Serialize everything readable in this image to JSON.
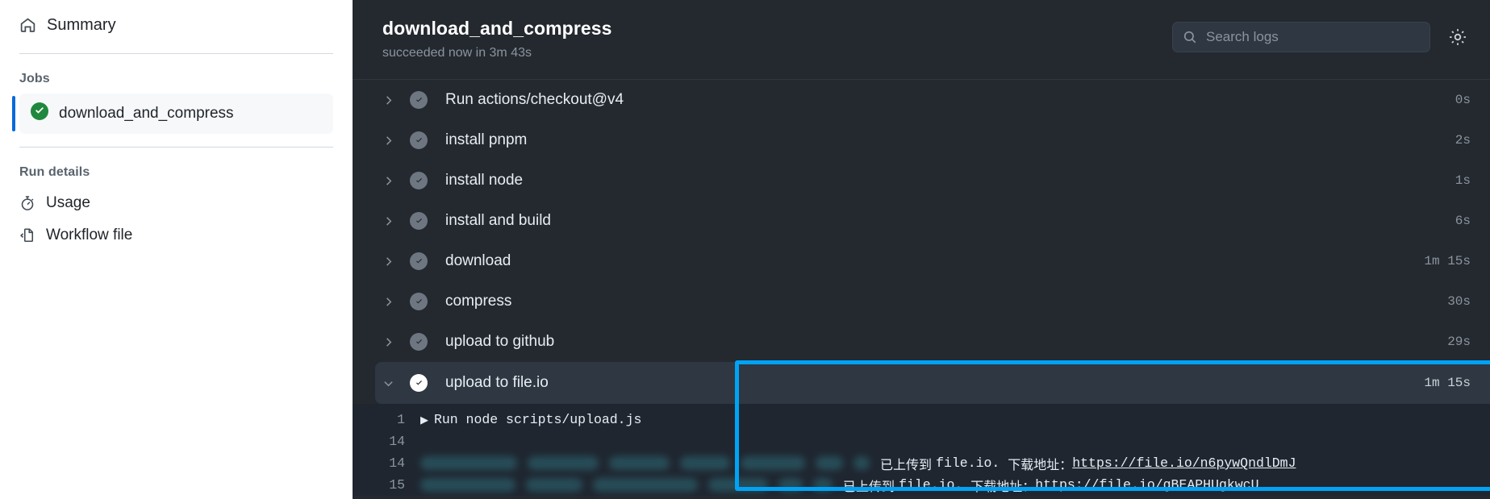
{
  "sidebar": {
    "summary": {
      "label": "Summary",
      "icon": "home-icon"
    },
    "jobs_title": "Jobs",
    "job": {
      "label": "download_and_compress",
      "status": "succeeded",
      "icon": "check-circle-icon"
    },
    "run_details_title": "Run details",
    "items": [
      {
        "label": "Usage",
        "icon": "stopwatch-icon"
      },
      {
        "label": "Workflow file",
        "icon": "code-file-icon"
      }
    ]
  },
  "header": {
    "title": "download_and_compress",
    "subtitle": "succeeded now in 3m 43s",
    "search": {
      "placeholder": "Search logs",
      "value": "",
      "icon": "search-icon"
    },
    "settings_icon": "gear-icon"
  },
  "steps": [
    {
      "label": "Run actions/checkout@v4",
      "duration": "0s",
      "state": "success",
      "expanded": false
    },
    {
      "label": "install pnpm",
      "duration": "2s",
      "state": "success",
      "expanded": false
    },
    {
      "label": "install node",
      "duration": "1s",
      "state": "success",
      "expanded": false
    },
    {
      "label": "install and build",
      "duration": "6s",
      "state": "success",
      "expanded": false
    },
    {
      "label": "download",
      "duration": "1m 15s",
      "state": "success",
      "expanded": false
    },
    {
      "label": "compress",
      "duration": "30s",
      "state": "success",
      "expanded": false
    },
    {
      "label": "upload to github",
      "duration": "29s",
      "state": "success",
      "expanded": false
    },
    {
      "label": "upload to file.io",
      "duration": "1m 15s",
      "state": "success",
      "expanded": true
    }
  ],
  "log": {
    "lines": [
      {
        "number": "1",
        "caret": "▶",
        "text": "Run node scripts/upload.js"
      },
      {
        "number": "14",
        "caret": "",
        "text": ""
      },
      {
        "number": "14",
        "caret": "",
        "message_cn": "已上传到 ",
        "message_mid": "file.io. ",
        "message_cn2": "下载地址：",
        "link": "https://file.io/n6pywQndlDmJ"
      },
      {
        "number": "15",
        "caret": "",
        "message_cn": "已上传到 ",
        "message_mid": "file.io. ",
        "message_cn2": "下载地址：",
        "link": "https://file.io/gBEAPHUgkwcU"
      }
    ]
  },
  "colors": {
    "highlight": "#00a3f5",
    "accent": "#0969da",
    "success": "#1f883d",
    "panel": "#24292f",
    "log_bg": "#1f2630"
  }
}
